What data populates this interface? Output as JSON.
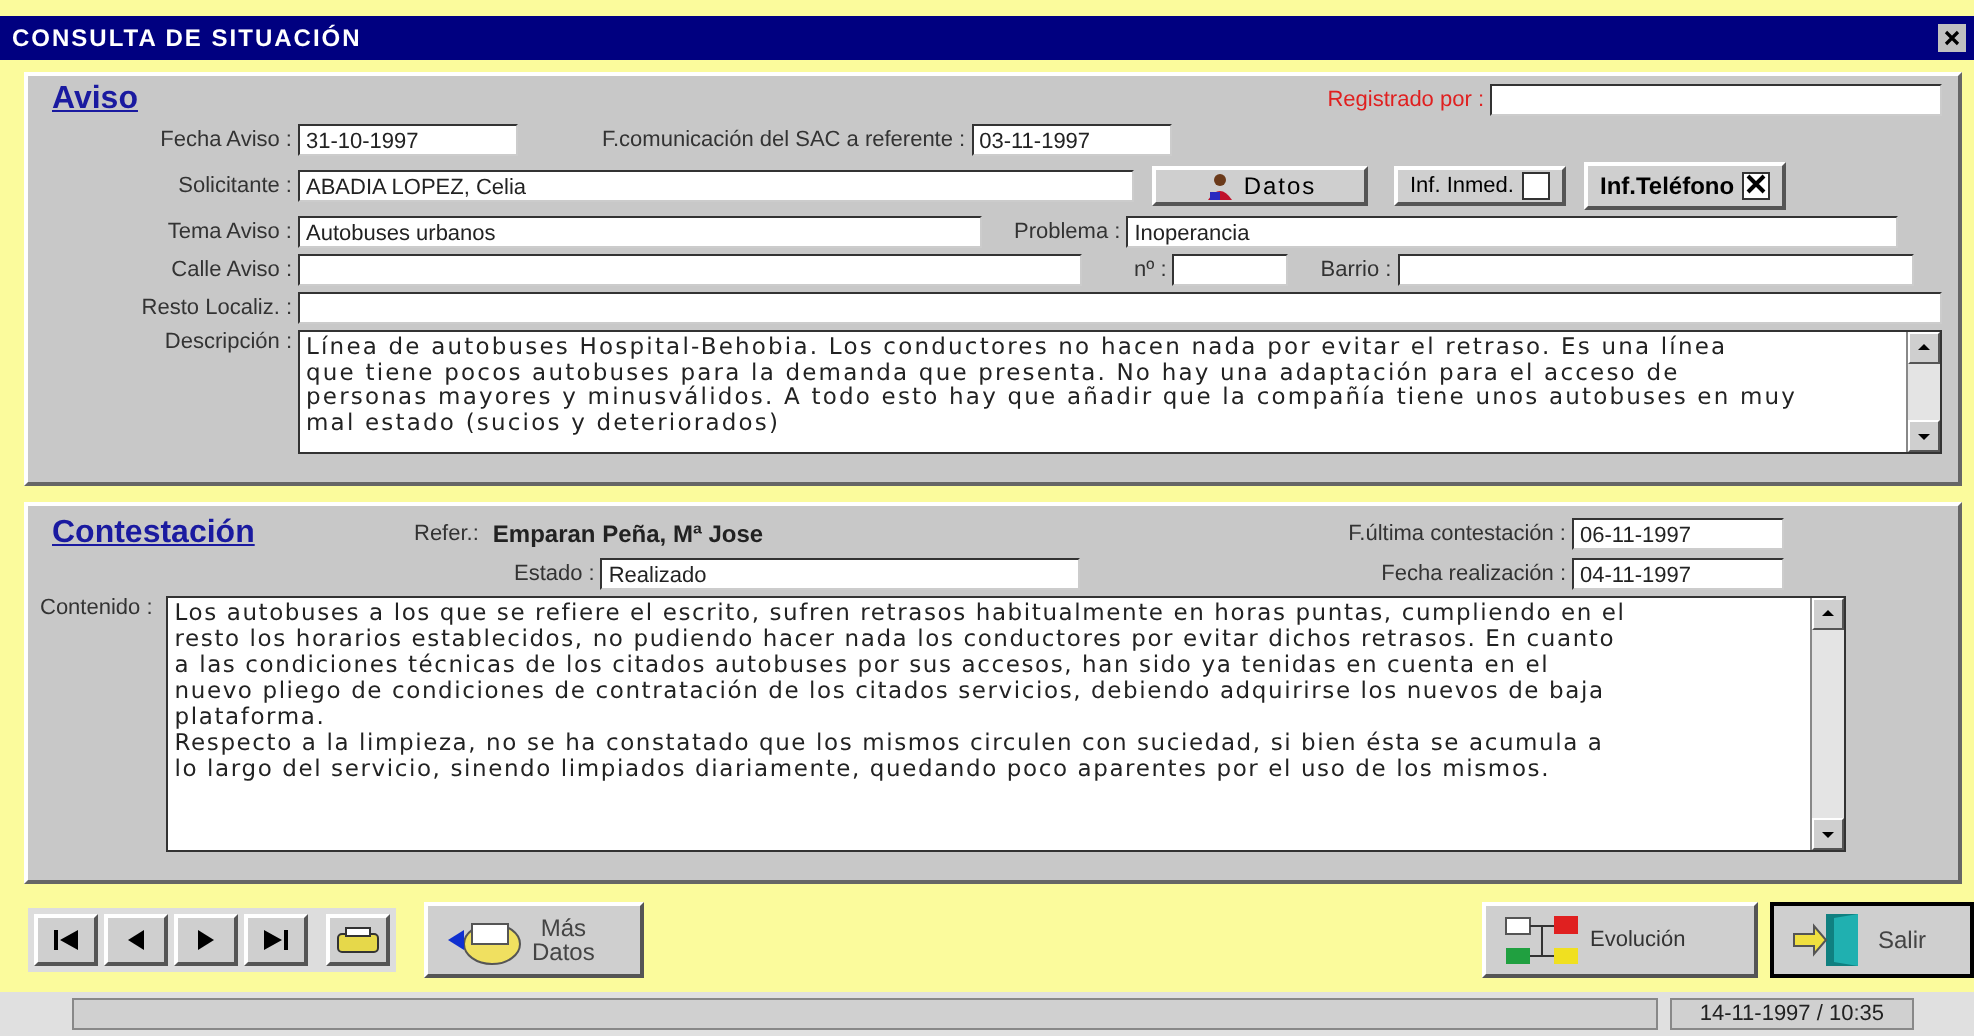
{
  "window": {
    "title": "CONSULTA DE SITUACIÓN"
  },
  "aviso": {
    "heading": "Aviso",
    "registrado_label": "Registrado por :",
    "fecha_label": "Fecha Aviso :",
    "fecha": "31-10-1997",
    "comunicacion_label": "F.comunicación del SAC a referente :",
    "comunicacion": "03-11-1997",
    "solicitante_label": "Solicitante :",
    "solicitante": "ABADIA LOPEZ, Celia",
    "datos_button": "Datos",
    "checks": [
      {
        "label": "Inf. Inmed.",
        "checked": false
      },
      {
        "label": "Inf.Teléfono",
        "checked": true
      }
    ],
    "tema_label": "Tema Aviso :",
    "tema": "Autobuses urbanos",
    "problema_label": "Problema :",
    "problema": "Inoperancia",
    "calle_label": "Calle Aviso :",
    "numero_label": "nº :",
    "barrio_label": "Barrio :",
    "resto_label": "Resto Localiz. :",
    "descripcion_label": "Descripción :",
    "descripcion": [
      "Línea de autobuses Hospital-Behobia. Los conductores no hacen nada por evitar el retraso. Es una línea",
      "que tiene pocos autobuses para la demanda que presenta. No hay una adaptación para el acceso de",
      "personas mayores y minusválidos. A todo esto hay que añadir que la compañía tiene unos autobuses en muy",
      "mal estado (sucios y deteriorados)"
    ]
  },
  "contestacion": {
    "heading": "Contestación",
    "refer_label": "Refer.:",
    "refer": "Emparan Peña, Mª Jose",
    "ultima_label": "F.última contestación :",
    "ultima": "06-11-1997",
    "estado_label": "Estado :",
    "estado": "Realizado",
    "realizacion_label": "Fecha realización :",
    "realizacion": "04-11-1997",
    "contenido_label": "Contenido :",
    "contenido": [
      "Los autobuses a los que se refiere el escrito, sufren retrasos habitualmente en horas puntas, cumpliendo en el",
      "resto los horarios establecidos, no pudiendo hacer nada los conductores por evitar dichos retrasos. En cuanto",
      "a las condiciones técnicas de los citados autobuses por sus accesos, han sido ya tenidas en cuenta en el",
      "nuevo pliego de condiciones de contratación de los citados servicios, debiendo adquirirse los nuevos de baja",
      "plataforma.",
      "Respecto a la limpieza, no se ha constatado que los mismos circulen con suciedad, si bien ésta se acumula a",
      "lo largo del servicio, sinendo limpiados diariamente, quedando poco aparentes por el uso de los mismos."
    ]
  },
  "toolbar": {
    "mas_datos": [
      "Más",
      "Datos"
    ],
    "evolucion": "Evolución",
    "salir": "Salir"
  },
  "status_bar": {
    "datetime": "14-11-1997 / 10:35"
  }
}
